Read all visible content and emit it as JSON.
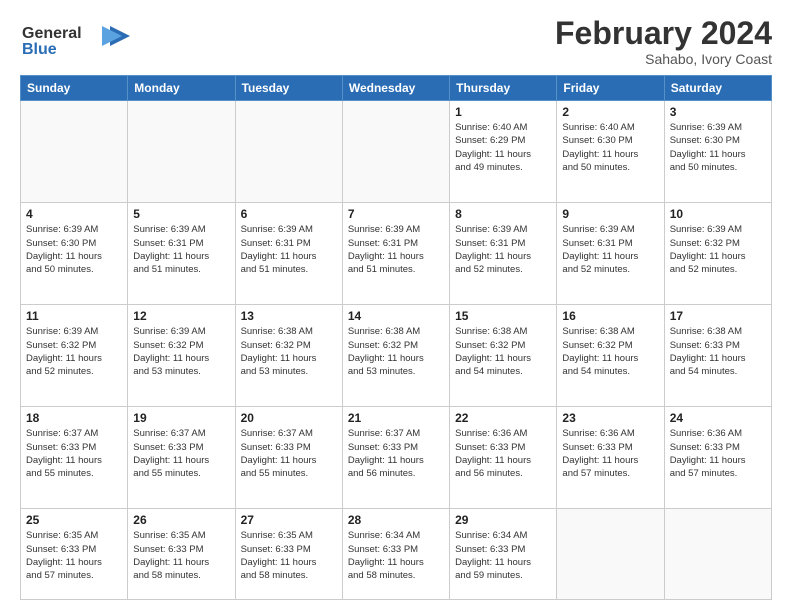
{
  "header": {
    "logo_general": "General",
    "logo_blue": "Blue",
    "month": "February 2024",
    "location": "Sahabo, Ivory Coast"
  },
  "days_of_week": [
    "Sunday",
    "Monday",
    "Tuesday",
    "Wednesday",
    "Thursday",
    "Friday",
    "Saturday"
  ],
  "weeks": [
    [
      {
        "day": "",
        "info": ""
      },
      {
        "day": "",
        "info": ""
      },
      {
        "day": "",
        "info": ""
      },
      {
        "day": "",
        "info": ""
      },
      {
        "day": "1",
        "info": "Sunrise: 6:40 AM\nSunset: 6:29 PM\nDaylight: 11 hours\nand 49 minutes."
      },
      {
        "day": "2",
        "info": "Sunrise: 6:40 AM\nSunset: 6:30 PM\nDaylight: 11 hours\nand 50 minutes."
      },
      {
        "day": "3",
        "info": "Sunrise: 6:39 AM\nSunset: 6:30 PM\nDaylight: 11 hours\nand 50 minutes."
      }
    ],
    [
      {
        "day": "4",
        "info": "Sunrise: 6:39 AM\nSunset: 6:30 PM\nDaylight: 11 hours\nand 50 minutes."
      },
      {
        "day": "5",
        "info": "Sunrise: 6:39 AM\nSunset: 6:31 PM\nDaylight: 11 hours\nand 51 minutes."
      },
      {
        "day": "6",
        "info": "Sunrise: 6:39 AM\nSunset: 6:31 PM\nDaylight: 11 hours\nand 51 minutes."
      },
      {
        "day": "7",
        "info": "Sunrise: 6:39 AM\nSunset: 6:31 PM\nDaylight: 11 hours\nand 51 minutes."
      },
      {
        "day": "8",
        "info": "Sunrise: 6:39 AM\nSunset: 6:31 PM\nDaylight: 11 hours\nand 52 minutes."
      },
      {
        "day": "9",
        "info": "Sunrise: 6:39 AM\nSunset: 6:31 PM\nDaylight: 11 hours\nand 52 minutes."
      },
      {
        "day": "10",
        "info": "Sunrise: 6:39 AM\nSunset: 6:32 PM\nDaylight: 11 hours\nand 52 minutes."
      }
    ],
    [
      {
        "day": "11",
        "info": "Sunrise: 6:39 AM\nSunset: 6:32 PM\nDaylight: 11 hours\nand 52 minutes."
      },
      {
        "day": "12",
        "info": "Sunrise: 6:39 AM\nSunset: 6:32 PM\nDaylight: 11 hours\nand 53 minutes."
      },
      {
        "day": "13",
        "info": "Sunrise: 6:38 AM\nSunset: 6:32 PM\nDaylight: 11 hours\nand 53 minutes."
      },
      {
        "day": "14",
        "info": "Sunrise: 6:38 AM\nSunset: 6:32 PM\nDaylight: 11 hours\nand 53 minutes."
      },
      {
        "day": "15",
        "info": "Sunrise: 6:38 AM\nSunset: 6:32 PM\nDaylight: 11 hours\nand 54 minutes."
      },
      {
        "day": "16",
        "info": "Sunrise: 6:38 AM\nSunset: 6:32 PM\nDaylight: 11 hours\nand 54 minutes."
      },
      {
        "day": "17",
        "info": "Sunrise: 6:38 AM\nSunset: 6:33 PM\nDaylight: 11 hours\nand 54 minutes."
      }
    ],
    [
      {
        "day": "18",
        "info": "Sunrise: 6:37 AM\nSunset: 6:33 PM\nDaylight: 11 hours\nand 55 minutes."
      },
      {
        "day": "19",
        "info": "Sunrise: 6:37 AM\nSunset: 6:33 PM\nDaylight: 11 hours\nand 55 minutes."
      },
      {
        "day": "20",
        "info": "Sunrise: 6:37 AM\nSunset: 6:33 PM\nDaylight: 11 hours\nand 55 minutes."
      },
      {
        "day": "21",
        "info": "Sunrise: 6:37 AM\nSunset: 6:33 PM\nDaylight: 11 hours\nand 56 minutes."
      },
      {
        "day": "22",
        "info": "Sunrise: 6:36 AM\nSunset: 6:33 PM\nDaylight: 11 hours\nand 56 minutes."
      },
      {
        "day": "23",
        "info": "Sunrise: 6:36 AM\nSunset: 6:33 PM\nDaylight: 11 hours\nand 57 minutes."
      },
      {
        "day": "24",
        "info": "Sunrise: 6:36 AM\nSunset: 6:33 PM\nDaylight: 11 hours\nand 57 minutes."
      }
    ],
    [
      {
        "day": "25",
        "info": "Sunrise: 6:35 AM\nSunset: 6:33 PM\nDaylight: 11 hours\nand 57 minutes."
      },
      {
        "day": "26",
        "info": "Sunrise: 6:35 AM\nSunset: 6:33 PM\nDaylight: 11 hours\nand 58 minutes."
      },
      {
        "day": "27",
        "info": "Sunrise: 6:35 AM\nSunset: 6:33 PM\nDaylight: 11 hours\nand 58 minutes."
      },
      {
        "day": "28",
        "info": "Sunrise: 6:34 AM\nSunset: 6:33 PM\nDaylight: 11 hours\nand 58 minutes."
      },
      {
        "day": "29",
        "info": "Sunrise: 6:34 AM\nSunset: 6:33 PM\nDaylight: 11 hours\nand 59 minutes."
      },
      {
        "day": "",
        "info": ""
      },
      {
        "day": "",
        "info": ""
      }
    ]
  ]
}
